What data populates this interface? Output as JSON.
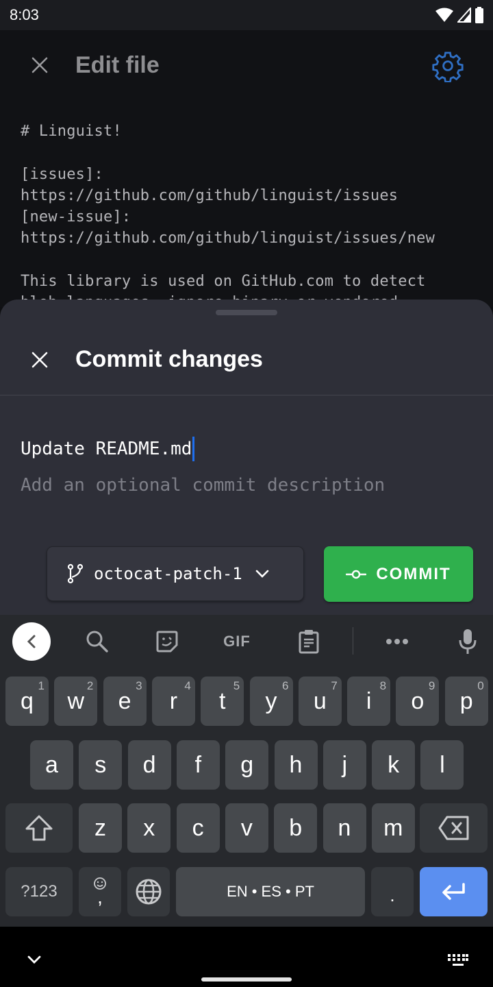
{
  "status_bar": {
    "time": "8:03",
    "icons": [
      "wifi-icon",
      "cell-signal-icon",
      "battery-icon"
    ]
  },
  "app_bar": {
    "title": "Edit file",
    "close_icon": "close-icon",
    "settings_icon": "gear-icon"
  },
  "editor": {
    "content": "# Linguist!\n\n[issues]:\nhttps://github.com/github/linguist/issues\n[new-issue]:\nhttps://github.com/github/linguist/issues/new\n\nThis library is used on GitHub.com to detect\nblob languages, ignore binary or vendored"
  },
  "commit_sheet": {
    "title": "Commit changes",
    "commit_message": {
      "value": "Update README.md"
    },
    "description": {
      "value": "",
      "placeholder": "Add an optional commit description"
    },
    "branch": {
      "label": "octocat-patch-1",
      "icon": "git-branch-icon"
    },
    "commit_button": {
      "label": "COMMIT",
      "icon": "git-commit-icon",
      "color": "#2fb04d"
    }
  },
  "keyboard": {
    "toolbar": [
      {
        "name": "back",
        "icon": "chevron-left-icon"
      },
      {
        "name": "search",
        "icon": "search-icon"
      },
      {
        "name": "sticker",
        "icon": "sticker-icon"
      },
      {
        "name": "gif",
        "label": "GIF"
      },
      {
        "name": "clipboard",
        "icon": "clipboard-icon"
      },
      {
        "name": "more",
        "icon": "more-horizontal-icon"
      },
      {
        "name": "voice",
        "icon": "microphone-icon"
      }
    ],
    "row1": [
      {
        "k": "q",
        "h": "1"
      },
      {
        "k": "w",
        "h": "2"
      },
      {
        "k": "e",
        "h": "3"
      },
      {
        "k": "r",
        "h": "4"
      },
      {
        "k": "t",
        "h": "5"
      },
      {
        "k": "y",
        "h": "6"
      },
      {
        "k": "u",
        "h": "7"
      },
      {
        "k": "i",
        "h": "8"
      },
      {
        "k": "o",
        "h": "9"
      },
      {
        "k": "p",
        "h": "0"
      }
    ],
    "row2": [
      "a",
      "s",
      "d",
      "f",
      "g",
      "h",
      "j",
      "k",
      "l"
    ],
    "row3": [
      "z",
      "x",
      "c",
      "v",
      "b",
      "n",
      "m"
    ],
    "symbols_label": "?123",
    "comma_label": ",",
    "space_label": "EN • ES • PT",
    "period_label": ".",
    "enter_color": "#5b8ff0"
  },
  "nav_bar": {
    "hide_keyboard_icon": "chevron-down-icon",
    "switch_keyboard_icon": "keyboard-icon"
  }
}
